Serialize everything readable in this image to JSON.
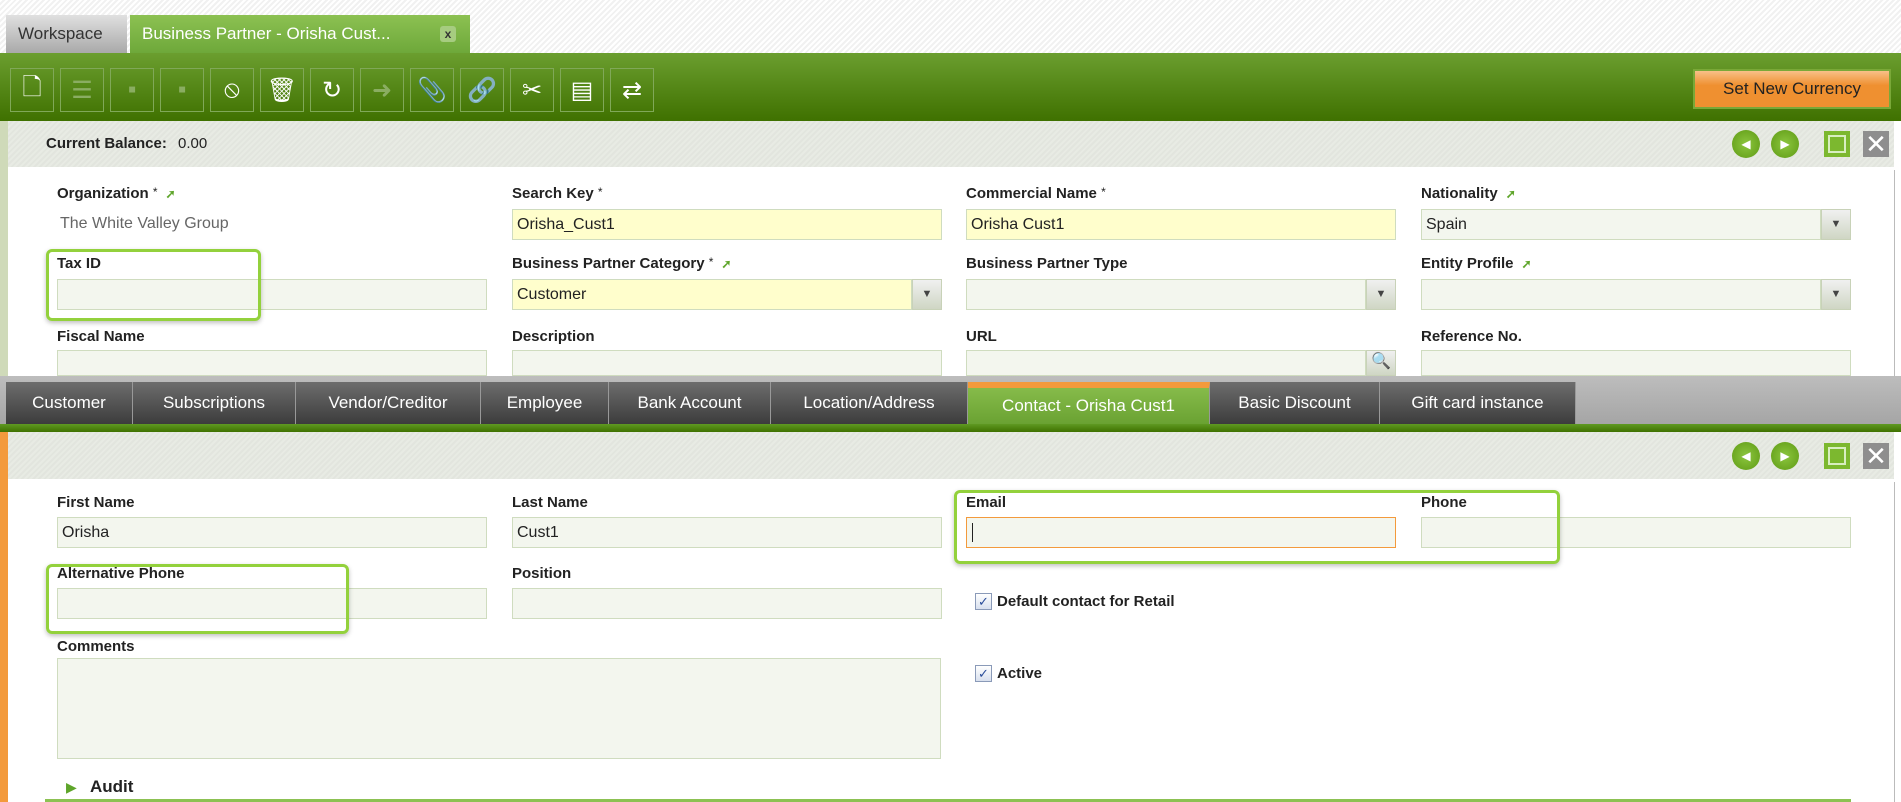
{
  "tabs": {
    "workspace": "Workspace",
    "active": "Business Partner - Orisha Cust...",
    "close": "x"
  },
  "toolbar": {
    "buttons": [
      {
        "name": "new-document",
        "glyph": "🗋"
      },
      {
        "name": "new-row",
        "glyph": "☰"
      },
      {
        "name": "save",
        "glyph": "▪"
      },
      {
        "name": "save-close",
        "glyph": "▪"
      },
      {
        "name": "undo",
        "glyph": "⦸"
      },
      {
        "name": "delete",
        "glyph": "🗑"
      },
      {
        "name": "refresh",
        "glyph": "↻"
      },
      {
        "name": "export",
        "glyph": "➜"
      },
      {
        "name": "attach",
        "glyph": "📎"
      },
      {
        "name": "link",
        "glyph": "🔗"
      },
      {
        "name": "customize",
        "glyph": "✂"
      },
      {
        "name": "form-grid",
        "glyph": "▤"
      },
      {
        "name": "workflow",
        "glyph": "⇄"
      }
    ],
    "set_new_currency": "Set New Currency"
  },
  "header": {
    "balance_label": "Current Balance:",
    "balance_value": "0.00"
  },
  "main_form": {
    "organization": {
      "label": "Organization",
      "value": "The White Valley Group"
    },
    "search_key": {
      "label": "Search Key",
      "value": "Orisha_Cust1"
    },
    "commercial_name": {
      "label": "Commercial Name",
      "value": "Orisha Cust1"
    },
    "nationality": {
      "label": "Nationality",
      "value": "Spain"
    },
    "tax_id": {
      "label": "Tax ID",
      "value": ""
    },
    "bp_category": {
      "label": "Business Partner Category",
      "value": "Customer"
    },
    "bp_type": {
      "label": "Business Partner Type",
      "value": ""
    },
    "entity_profile": {
      "label": "Entity Profile",
      "value": ""
    },
    "fiscal_name": {
      "label": "Fiscal Name",
      "value": ""
    },
    "description": {
      "label": "Description",
      "value": ""
    },
    "url": {
      "label": "URL",
      "value": ""
    },
    "reference_no": {
      "label": "Reference No.",
      "value": ""
    },
    "required_mark": "*"
  },
  "child_tabs": [
    "Customer",
    "Subscriptions",
    "Vendor/Creditor",
    "Employee",
    "Bank Account",
    "Location/Address",
    "Contact - Orisha Cust1",
    "Basic Discount",
    "Gift card instance"
  ],
  "contact_form": {
    "first_name": {
      "label": "First Name",
      "value": "Orisha"
    },
    "last_name": {
      "label": "Last Name",
      "value": "Cust1"
    },
    "email": {
      "label": "Email",
      "value": ""
    },
    "phone": {
      "label": "Phone",
      "value": ""
    },
    "alternative_phone": {
      "label": "Alternative Phone",
      "value": ""
    },
    "position": {
      "label": "Position",
      "value": ""
    },
    "default_contact": {
      "label": "Default contact for Retail",
      "checked": true
    },
    "comments": {
      "label": "Comments",
      "value": ""
    },
    "active": {
      "label": "Active",
      "checked": true
    },
    "audit": "Audit"
  }
}
